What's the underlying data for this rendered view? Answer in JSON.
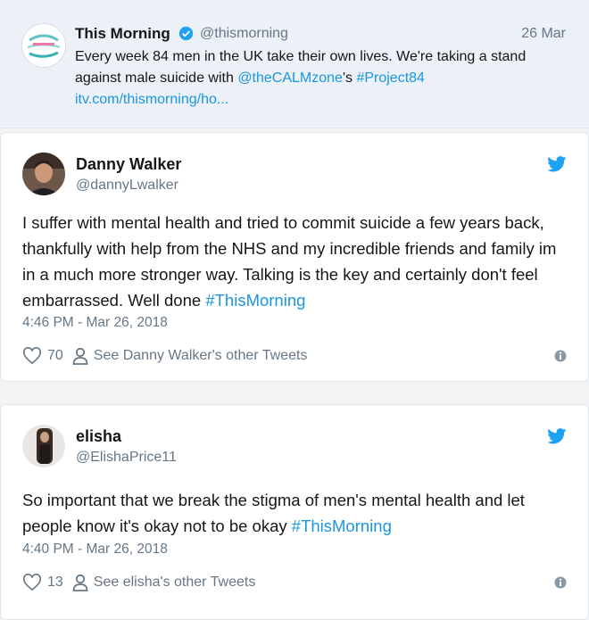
{
  "quoted_tweet": {
    "name": "This Morning",
    "handle": "@thismorning",
    "date": "26 Mar",
    "text_prefix": "Every week 84 men in the UK take their own lives. We're taking a stand against male suicide with ",
    "mention": "@theCALMzone",
    "text_mid": "'s ",
    "hashtag": "#Project84",
    "link": "itv.com/thismorning/ho..."
  },
  "tweets": [
    {
      "name": "Danny Walker",
      "handle": "@dannyLwalker",
      "text": "I suffer with mental health and tried to commit suicide a few years back, thankfully with help from the NHS and my incredible friends and family im in a much more stronger way. Talking is the key and certainly don't feel embarrassed. Well done ",
      "hashtag": "#ThisMorning",
      "timestamp": "4:46 PM - Mar 26, 2018",
      "likes": "70",
      "other_tweets_link": "See Danny Walker's other Tweets"
    },
    {
      "name": "elisha",
      "handle": "@ElishaPrice11",
      "text": "So important that we break the stigma of men's mental health and let people know it's okay not to be okay ",
      "hashtag": "#ThisMorning",
      "timestamp": "4:40 PM - Mar 26, 2018",
      "likes": "13",
      "other_tweets_link": "See elisha's other Tweets"
    }
  ],
  "colors": {
    "link": "#1b95e0",
    "secondary_text": "#657786",
    "twitter_blue": "#1da1f2"
  }
}
